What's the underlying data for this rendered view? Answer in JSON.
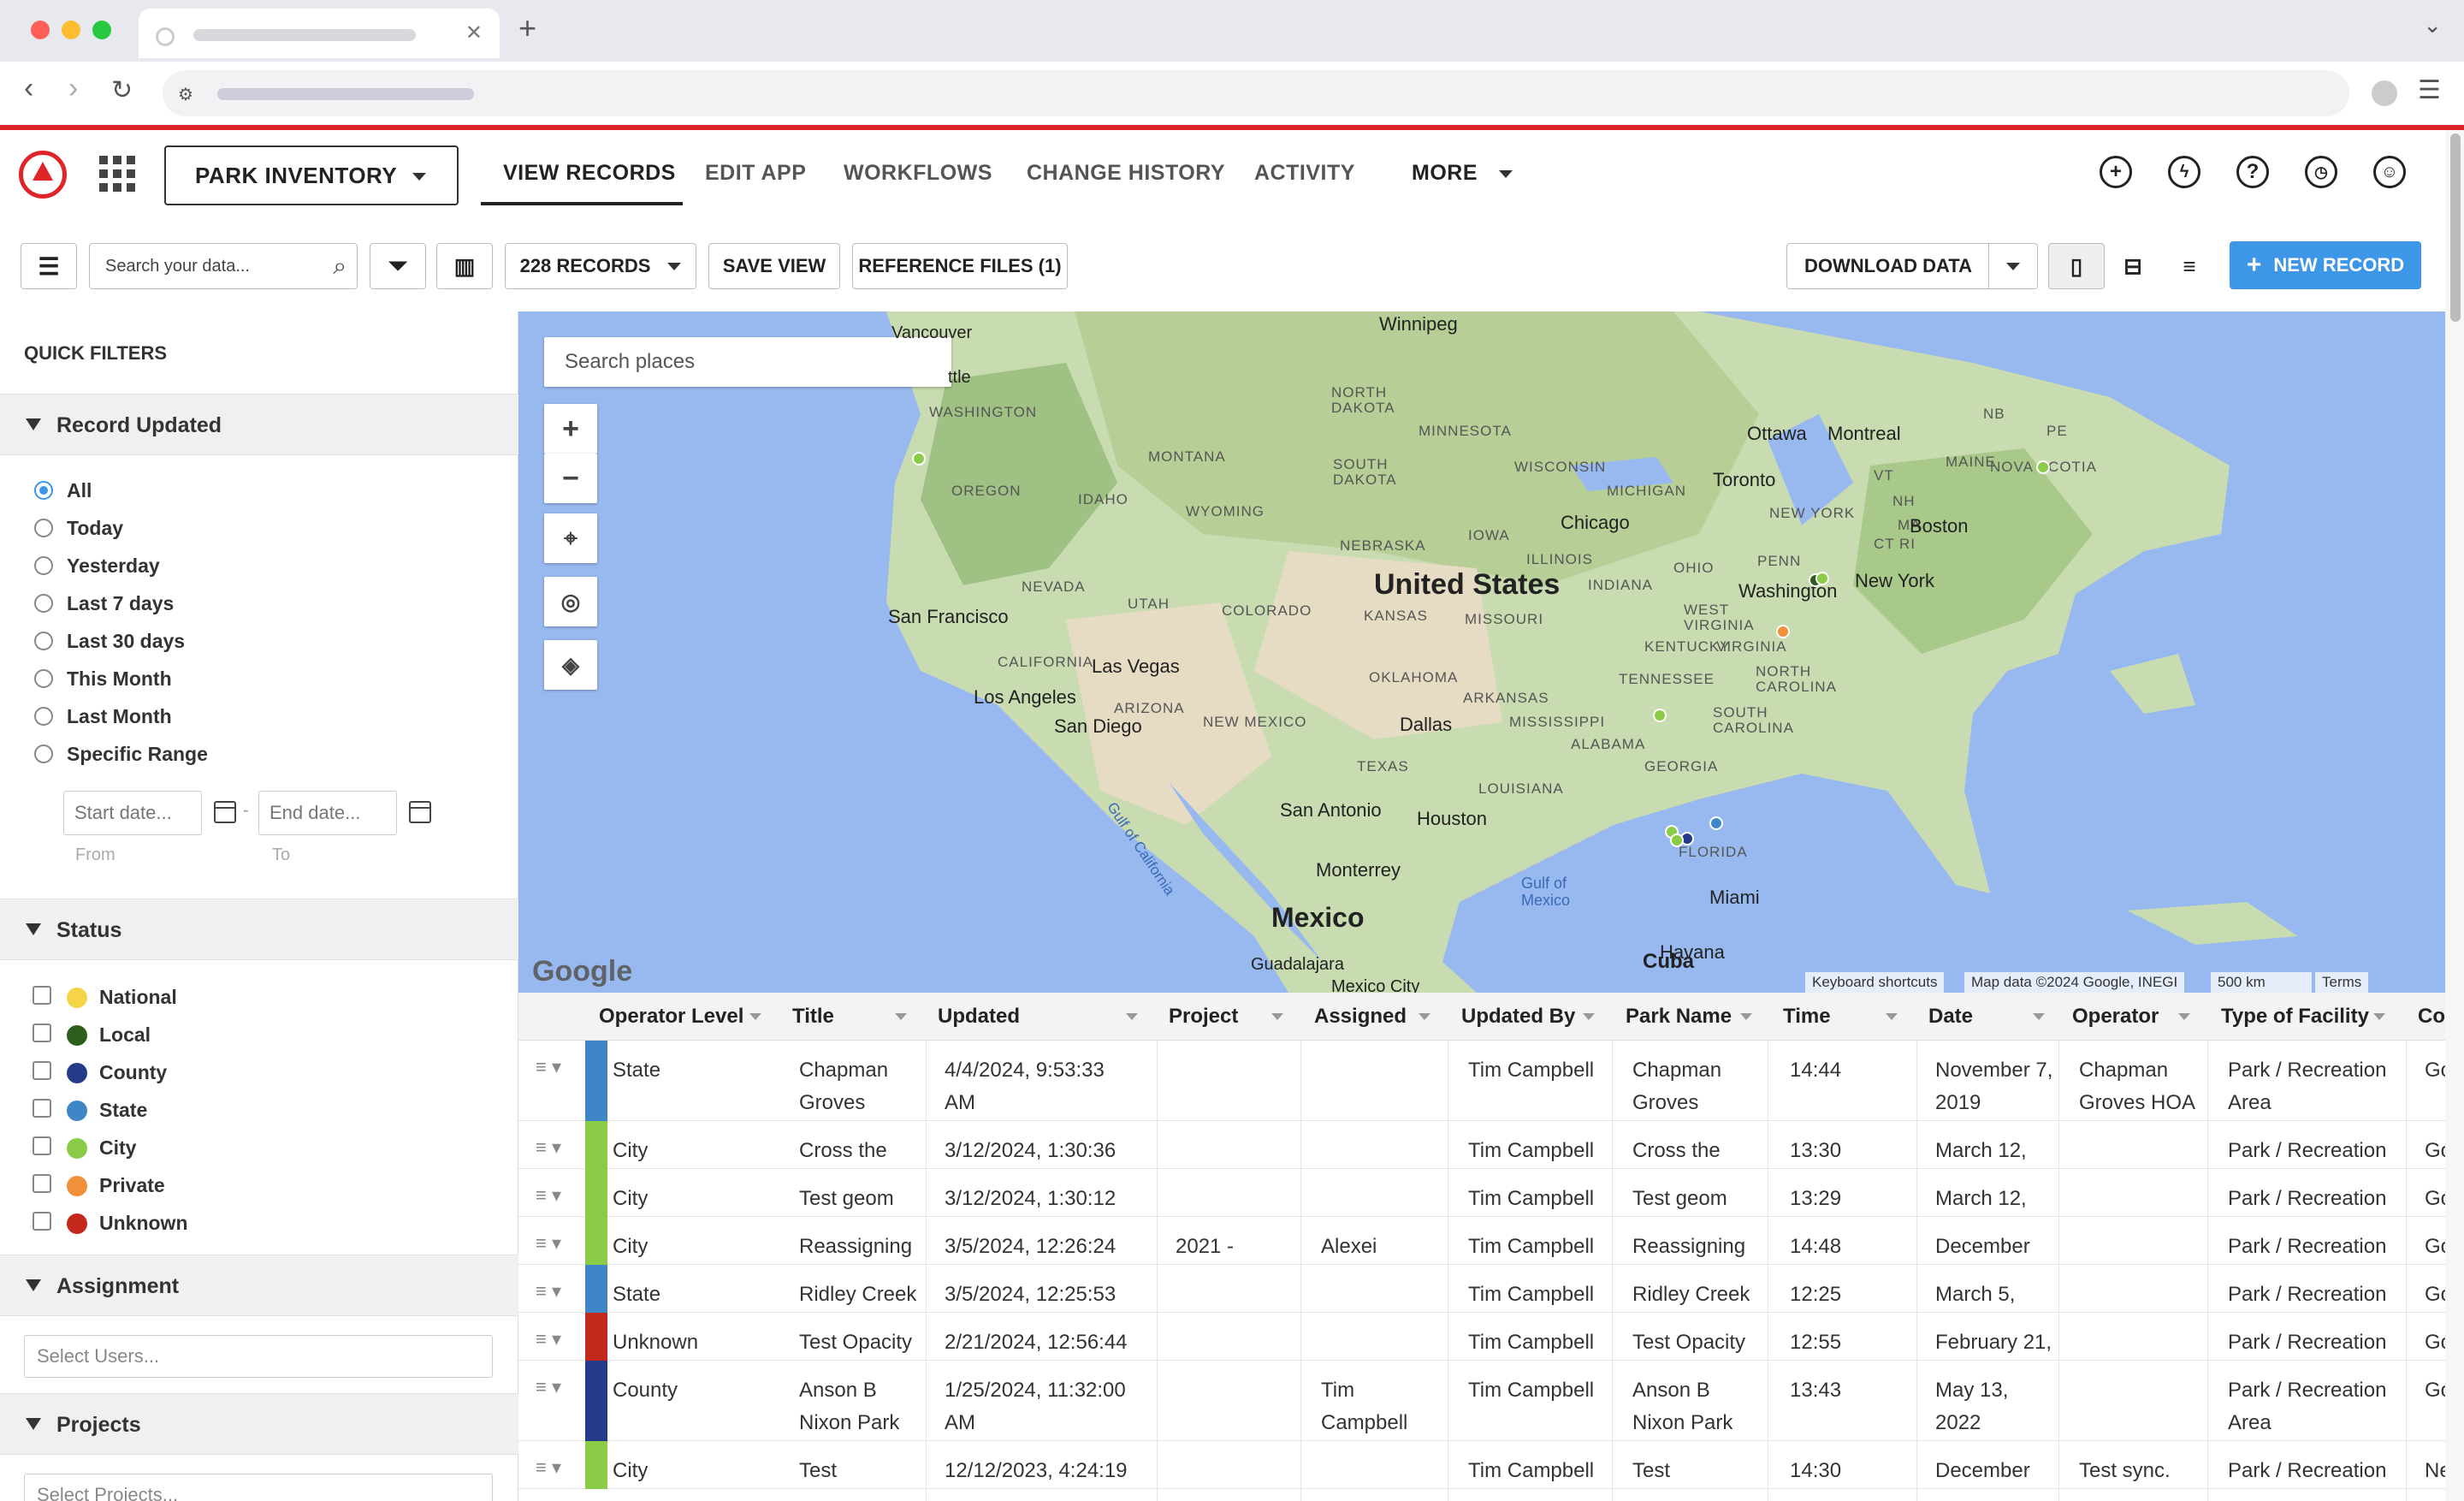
{
  "app": {
    "selector": "PARK INVENTORY",
    "tabs": [
      "VIEW RECORDS",
      "EDIT APP",
      "WORKFLOWS",
      "CHANGE HISTORY",
      "ACTIVITY",
      "MORE"
    ]
  },
  "toolbar": {
    "search_placeholder": "Search your data...",
    "records": "228 RECORDS",
    "save_view": "SAVE VIEW",
    "reference_files": "REFERENCE FILES (1)",
    "download": "DOWNLOAD DATA",
    "new_record": "NEW RECORD"
  },
  "sidebar": {
    "title": "QUICK FILTERS",
    "record_updated": {
      "title": "Record Updated",
      "options": [
        "All",
        "Today",
        "Yesterday",
        "Last 7 days",
        "Last 30 days",
        "This Month",
        "Last Month",
        "Specific Range"
      ],
      "selected": "All",
      "start_placeholder": "Start date...",
      "end_placeholder": "End date...",
      "from": "From",
      "to": "To"
    },
    "status": {
      "title": "Status",
      "items": [
        {
          "label": "National",
          "color": "#f5d547"
        },
        {
          "label": "Local",
          "color": "#2e5e1e"
        },
        {
          "label": "County",
          "color": "#263a8a"
        },
        {
          "label": "State",
          "color": "#3f86c6"
        },
        {
          "label": "City",
          "color": "#8acc47"
        },
        {
          "label": "Private",
          "color": "#f0913a"
        },
        {
          "label": "Unknown",
          "color": "#c4281c"
        }
      ]
    },
    "assignment": {
      "title": "Assignment",
      "placeholder": "Select Users..."
    },
    "projects": {
      "title": "Projects",
      "placeholder": "Select Projects..."
    }
  },
  "map": {
    "search_placeholder": "Search places",
    "attribution": "Keyboard shortcuts",
    "data": "Map data ©2024 Google, INEGI",
    "scale": "500 km",
    "terms": "Terms",
    "google": "Google",
    "labels": {
      "us": "United States",
      "mexico": "Mexico",
      "cuba": "Cuba",
      "winnipeg": "Winnipeg",
      "vancouver": "Vancouver",
      "seattle": "ttle",
      "washington": "WASHINGTON",
      "oregon": "OREGON",
      "idaho": "IDAHO",
      "montana": "MONTANA",
      "wyoming": "WYOMING",
      "nevada": "NEVADA",
      "utah": "UTAH",
      "colorado": "COLORADO",
      "california": "CALIFORNIA",
      "arizona": "ARIZONA",
      "newmexico": "NEW MEXICO",
      "ndakota": "NORTH DAKOTA",
      "sdakota": "SOUTH DAKOTA",
      "nebraska": "NEBRASKA",
      "kansas": "KANSAS",
      "oklahoma": "OKLAHOMA",
      "texas": "TEXAS",
      "minnesota": "MINNESOTA",
      "iowa": "IOWA",
      "missouri": "MISSOURI",
      "arkansas": "ARKANSAS",
      "louisiana": "LOUISIANA",
      "wisconsin": "WISCONSIN",
      "illinois": "ILLINOIS",
      "michigan": "MICHIGAN",
      "indiana": "INDIANA",
      "ohio": "OHIO",
      "kentucky": "KENTUCKY",
      "tennessee": "TENNESSEE",
      "mississippi": "MISSISSIPPI",
      "alabama": "ALABAMA",
      "georgia": "GEORGIA",
      "florida": "FLORIDA",
      "scarolina": "SOUTH CAROLINA",
      "ncarolina": "NORTH CAROLINA",
      "virginia": "VIRGINIA",
      "wvirginia": "WEST VIRGINIA",
      "penn": "PENN",
      "newyorkst": "NEW YORK",
      "maine": "MAINE",
      "vt": "VT",
      "nh": "NH",
      "ma": "MA",
      "ct": "CT",
      "ri": "RI",
      "nb": "NB",
      "pe": "PE",
      "novascotia": "NOVA SCOTIA",
      "sf": "San Francisco",
      "la": "Los Angeles",
      "lv": "Las Vegas",
      "sd": "San Diego",
      "dallas": "Dallas",
      "houston": "Houston",
      "sa": "San Antonio",
      "monterrey": "Monterrey",
      "chicago": "Chicago",
      "toronto": "Toronto",
      "ottawa": "Ottawa",
      "montreal": "Montreal",
      "boston": "Boston",
      "nyc": "New York",
      "dc": "Washington",
      "miami": "Miami",
      "havana": "Havana",
      "gulf": "Gulf of Mexico",
      "gulfcal": "Gulf of California",
      "guadalajara": "Guadalajara",
      "mexcity": "Mexico City"
    }
  },
  "table": {
    "headers": [
      "Operator Level",
      "Title",
      "Updated",
      "Project",
      "Assigned",
      "Updated By",
      "Park Name",
      "Time",
      "Date",
      "Operator",
      "Type of Facility",
      "Co"
    ],
    "rows": [
      {
        "color": "#3f86c6",
        "level": "State",
        "title": "Chapman\nGroves",
        "updated": "4/4/2024, 9:53:33\nAM",
        "project": "",
        "assigned": "",
        "by": "Tim Campbell",
        "park": "Chapman\nGroves",
        "time": "14:44",
        "date": "November 7,\n2019",
        "operator": "Chapman\nGroves HOA",
        "type": "Park / Recreation\nArea",
        "co": "Go"
      },
      {
        "color": "#8acc47",
        "level": "City",
        "title": "Cross the",
        "updated": "3/12/2024, 1:30:36",
        "project": "",
        "assigned": "",
        "by": "Tim Campbell",
        "park": "Cross the",
        "time": "13:30",
        "date": "March 12,",
        "operator": "",
        "type": "Park / Recreation",
        "co": "Go"
      },
      {
        "color": "#8acc47",
        "level": "City",
        "title": "Test geom",
        "updated": "3/12/2024, 1:30:12",
        "project": "",
        "assigned": "",
        "by": "Tim Campbell",
        "park": "Test geom",
        "time": "13:29",
        "date": "March 12,",
        "operator": "",
        "type": "Park / Recreation",
        "co": "Go"
      },
      {
        "color": "#8acc47",
        "level": "City",
        "title": "Reassigning",
        "updated": "3/5/2024, 12:26:24",
        "project": "2021 -",
        "assigned": "Alexei",
        "by": "Tim Campbell",
        "park": "Reassigning",
        "time": "14:48",
        "date": "December",
        "operator": "",
        "type": "Park / Recreation",
        "co": "Go"
      },
      {
        "color": "#3f86c6",
        "level": "State",
        "title": "Ridley Creek",
        "updated": "3/5/2024, 12:25:53",
        "project": "",
        "assigned": "",
        "by": "Tim Campbell",
        "park": "Ridley Creek",
        "time": "12:25",
        "date": "March 5,",
        "operator": "",
        "type": "Park / Recreation",
        "co": "Go"
      },
      {
        "color": "#c4281c",
        "level": "Unknown",
        "title": "Test Opacity",
        "updated": "2/21/2024, 12:56:44",
        "project": "",
        "assigned": "",
        "by": "Tim Campbell",
        "park": "Test Opacity",
        "time": "12:55",
        "date": "February 21,",
        "operator": "",
        "type": "Park / Recreation",
        "co": "Go"
      },
      {
        "color": "#263a8a",
        "level": "County",
        "title": "Anson B\nNixon Park",
        "updated": "1/25/2024, 11:32:00\nAM",
        "project": "",
        "assigned": "Tim\nCampbell",
        "by": "Tim Campbell",
        "park": "Anson B\nNixon Park",
        "time": "13:43",
        "date": "May 13,\n2022",
        "operator": "",
        "type": "Park / Recreation\nArea",
        "co": "Go"
      },
      {
        "color": "#8acc47",
        "level": "City",
        "title": "Test",
        "updated": "12/12/2023, 4:24:19",
        "project": "",
        "assigned": "",
        "by": "Tim Campbell",
        "park": "Test",
        "time": "14:30",
        "date": "December",
        "operator": "Test sync.",
        "type": "Park / Recreation",
        "co": "Ne"
      }
    ]
  }
}
